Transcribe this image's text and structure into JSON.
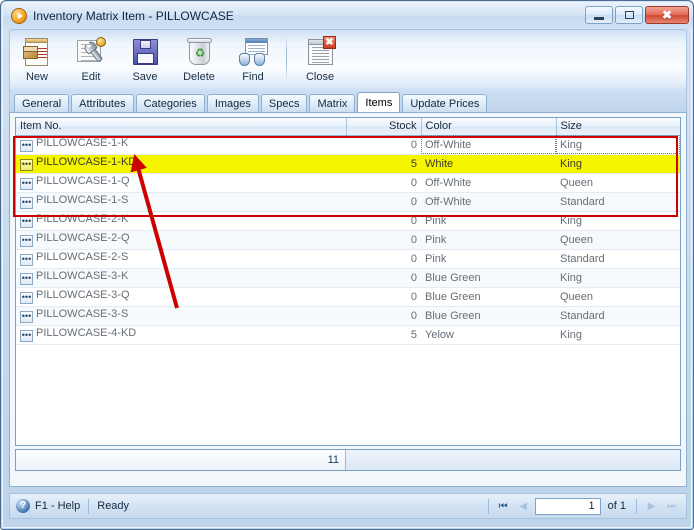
{
  "window": {
    "title": "Inventory Matrix Item - PILLOWCASE",
    "icon": "play-circle-icon",
    "minimize_label": "Minimize",
    "maximize_label": "Maximize",
    "close_label": "Close"
  },
  "toolbar": {
    "items": [
      {
        "label": "New",
        "icon": "new-document-icon"
      },
      {
        "label": "Edit",
        "icon": "wrench-edit-icon"
      },
      {
        "label": "Save",
        "icon": "floppy-disk-icon"
      },
      {
        "label": "Delete",
        "icon": "recycle-bin-icon"
      },
      {
        "label": "Find",
        "icon": "binoculars-icon"
      },
      {
        "label": "Close",
        "icon": "close-document-icon"
      }
    ]
  },
  "tabs": [
    {
      "label": "General",
      "active": false
    },
    {
      "label": "Attributes",
      "active": false
    },
    {
      "label": "Categories",
      "active": false
    },
    {
      "label": "Images",
      "active": false
    },
    {
      "label": "Specs",
      "active": false
    },
    {
      "label": "Matrix",
      "active": false
    },
    {
      "label": "Items",
      "active": true
    },
    {
      "label": "Update Prices",
      "active": false
    }
  ],
  "grid": {
    "columns": [
      {
        "label": "Item No.",
        "align": "left"
      },
      {
        "label": "Stock",
        "align": "right"
      },
      {
        "label": "Color",
        "align": "left"
      },
      {
        "label": "Size",
        "align": "left"
      }
    ],
    "rows": [
      {
        "item_no": "PILLOWCASE-1-K",
        "stock": "0",
        "color": "Off-White",
        "size": "King",
        "highlighted": false
      },
      {
        "item_no": "PILLOWCASE-1-KD",
        "stock": "5",
        "color": "White",
        "size": "King",
        "highlighted": true
      },
      {
        "item_no": "PILLOWCASE-1-Q",
        "stock": "0",
        "color": "Off-White",
        "size": "Queen",
        "highlighted": false
      },
      {
        "item_no": "PILLOWCASE-1-S",
        "stock": "0",
        "color": "Off-White",
        "size": "Standard",
        "highlighted": false
      },
      {
        "item_no": "PILLOWCASE-2-K",
        "stock": "0",
        "color": "Pink",
        "size": "King",
        "highlighted": false
      },
      {
        "item_no": "PILLOWCASE-2-Q",
        "stock": "0",
        "color": "Pink",
        "size": "Queen",
        "highlighted": false
      },
      {
        "item_no": "PILLOWCASE-2-S",
        "stock": "0",
        "color": "Pink",
        "size": "Standard",
        "highlighted": false
      },
      {
        "item_no": "PILLOWCASE-3-K",
        "stock": "0",
        "color": "Blue Green",
        "size": "King",
        "highlighted": false
      },
      {
        "item_no": "PILLOWCASE-3-Q",
        "stock": "0",
        "color": "Blue Green",
        "size": "Queen",
        "highlighted": false
      },
      {
        "item_no": "PILLOWCASE-3-S",
        "stock": "0",
        "color": "Blue Green",
        "size": "Standard",
        "highlighted": false
      },
      {
        "item_no": "PILLOWCASE-4-KD",
        "stock": "5",
        "color": "Yelow",
        "size": "King",
        "highlighted": false
      }
    ],
    "row_button_glyph": "•••",
    "summary_count": "11"
  },
  "statusbar": {
    "help_label": "F1 - Help",
    "status_text": "Ready",
    "nav": {
      "first_glyph": "⏮",
      "prev_glyph": "◀",
      "next_glyph": "▶",
      "last_glyph": "⏭",
      "page_value": "1",
      "of_label": "of 1"
    }
  },
  "annotations": {
    "highlight_rect_color": "#cc0000",
    "arrow_color": "#cc0000"
  }
}
